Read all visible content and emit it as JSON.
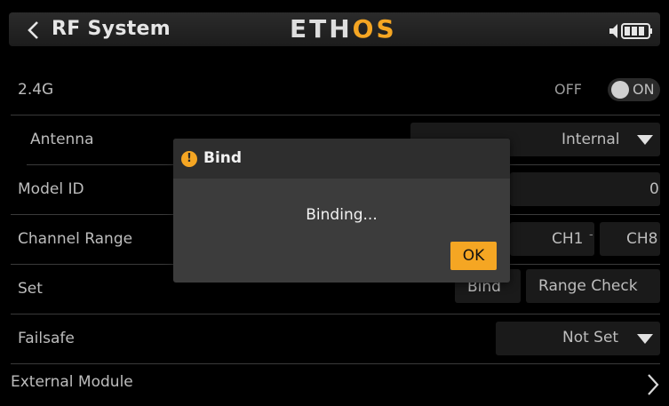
{
  "header": {
    "title": "RF System",
    "logo_part1": "ETH",
    "logo_part2": "OS",
    "accent": "#f5a623",
    "icons": [
      "chevron-left-icon",
      "speaker-icon",
      "battery-icon"
    ]
  },
  "rows": {
    "rf_24g": {
      "label": "2.4G",
      "toggle_off": "OFF",
      "toggle_on": "ON"
    },
    "antenna": {
      "label": "Antenna",
      "value": "Internal"
    },
    "model_id": {
      "label": "Model ID",
      "value": "0"
    },
    "channel_range": {
      "label": "Channel Range",
      "start": "CH1",
      "separator": "-",
      "end": "CH8"
    },
    "set": {
      "label": "Set",
      "bind_button": "Bind",
      "range_check_button": "Range Check"
    },
    "failsafe": {
      "label": "Failsafe",
      "value": "Not Set"
    },
    "external_module": {
      "label": "External Module"
    }
  },
  "dialog": {
    "title": "Bind",
    "icon": "alert-icon",
    "message": "Binding...",
    "ok_label": "OK"
  }
}
